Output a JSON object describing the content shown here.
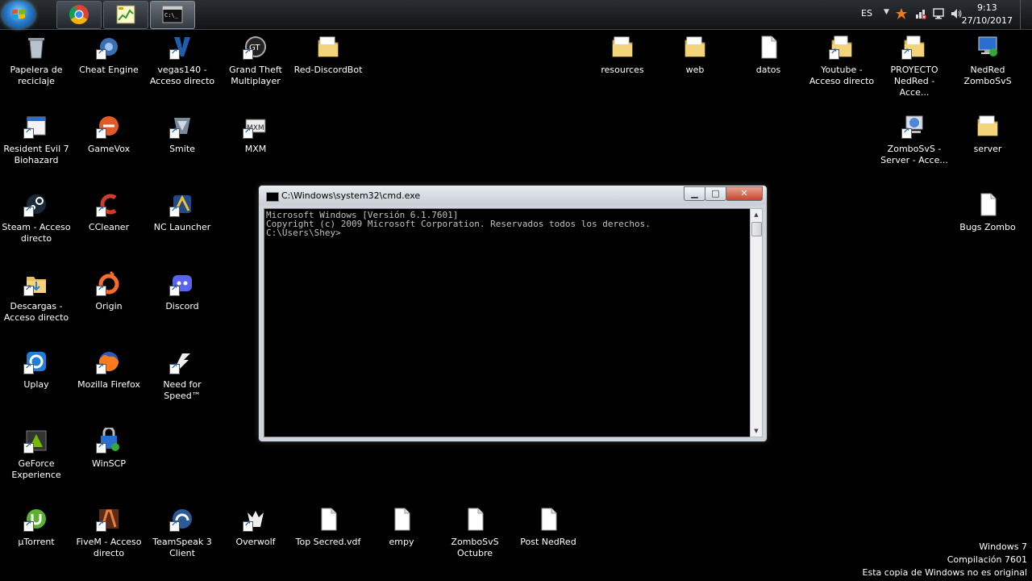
{
  "taskbar": {
    "buttons": [
      {
        "name": "Google Chrome",
        "icon": "chrome-icon"
      },
      {
        "name": "Task Manager",
        "icon": "graph-app-icon"
      },
      {
        "name": "Command Prompt",
        "icon": "cmd-icon",
        "active": true
      }
    ],
    "tray": {
      "language": "ES",
      "icons": [
        "avast-icon",
        "network-icon",
        "network-wired-icon",
        "volume-icon"
      ],
      "time": "9:13",
      "date": "27/10/2017"
    }
  },
  "desktop": {
    "icons": [
      {
        "label": "Papelera de reciclaje",
        "icon": "recycle-bin-icon"
      },
      {
        "label": "Cheat Engine",
        "icon": "cheat-engine-icon"
      },
      {
        "label": "vegas140 - Acceso directo",
        "icon": "vegas-icon"
      },
      {
        "label": "Grand Theft Multiplayer",
        "icon": "gtm-icon"
      },
      {
        "label": "Red-DiscordBot",
        "icon": "folder-icon"
      },
      {
        "label": "resources",
        "icon": "folder-icon"
      },
      {
        "label": "web",
        "icon": "folder-icon"
      },
      {
        "label": "datos",
        "icon": "file-icon"
      },
      {
        "label": "Youtube - Acceso directo",
        "icon": "folder-shortcut-icon"
      },
      {
        "label": "PROYECTO NedRed - Acce...",
        "icon": "folder-shortcut-icon"
      },
      {
        "label": "NedRed ZomboSvS",
        "icon": "network-computer-icon"
      },
      {
        "label": "Resident Evil 7 Biohazard",
        "icon": "app-shortcut-icon"
      },
      {
        "label": "GameVox",
        "icon": "gamevox-icon"
      },
      {
        "label": "Smite",
        "icon": "smite-icon"
      },
      {
        "label": "MXM",
        "icon": "mxm-icon"
      },
      {
        "label": "ZomboSvS - Server - Acce...",
        "icon": "network-shortcut-icon"
      },
      {
        "label": "server",
        "icon": "folder-icon"
      },
      {
        "label": "Steam - Acceso directo",
        "icon": "steam-icon"
      },
      {
        "label": "CCleaner",
        "icon": "ccleaner-icon"
      },
      {
        "label": "NC Launcher",
        "icon": "nc-launcher-icon"
      },
      {
        "label": "Bugs Zombo",
        "icon": "file-icon"
      },
      {
        "label": "Descargas - Acceso directo",
        "icon": "downloads-folder-icon"
      },
      {
        "label": "Origin",
        "icon": "origin-icon"
      },
      {
        "label": "Discord",
        "icon": "discord-icon"
      },
      {
        "label": "Uplay",
        "icon": "uplay-icon"
      },
      {
        "label": "Mozilla Firefox",
        "icon": "firefox-icon"
      },
      {
        "label": "Need for Speed™",
        "icon": "nfs-icon"
      },
      {
        "label": "GeForce Experience",
        "icon": "geforce-icon"
      },
      {
        "label": "WinSCP",
        "icon": "winscp-icon"
      },
      {
        "label": "µTorrent",
        "icon": "utorrent-icon"
      },
      {
        "label": "FiveM - Acceso directo",
        "icon": "fivem-icon"
      },
      {
        "label": "TeamSpeak 3 Client",
        "icon": "teamspeak-icon"
      },
      {
        "label": "Overwolf",
        "icon": "overwolf-icon"
      },
      {
        "label": "Top Secred.vdf",
        "icon": "file-icon"
      },
      {
        "label": "empy",
        "icon": "file-icon"
      },
      {
        "label": "ZomboSvS Octubre",
        "icon": "file-icon"
      },
      {
        "label": "Post NedRed",
        "icon": "file-icon"
      }
    ]
  },
  "cmd_window": {
    "title": "C:\\Windows\\system32\\cmd.exe",
    "minimize": "▁",
    "maximize": "□",
    "close": "✕",
    "lines": [
      "Microsoft Windows [Versión 6.1.7601]",
      "Copyright (c) 2009 Microsoft Corporation. Reservados todos los derechos.",
      "",
      "C:\\Users\\Shey>"
    ]
  },
  "watermark": {
    "line1": "Windows 7",
    "line2": "Compilación  7601",
    "line3": "Esta copia de Windows no es original"
  },
  "colors": {
    "desktop_bg": "#000000",
    "console_text": "#c0c0c0",
    "close_button": "#c7442b"
  }
}
